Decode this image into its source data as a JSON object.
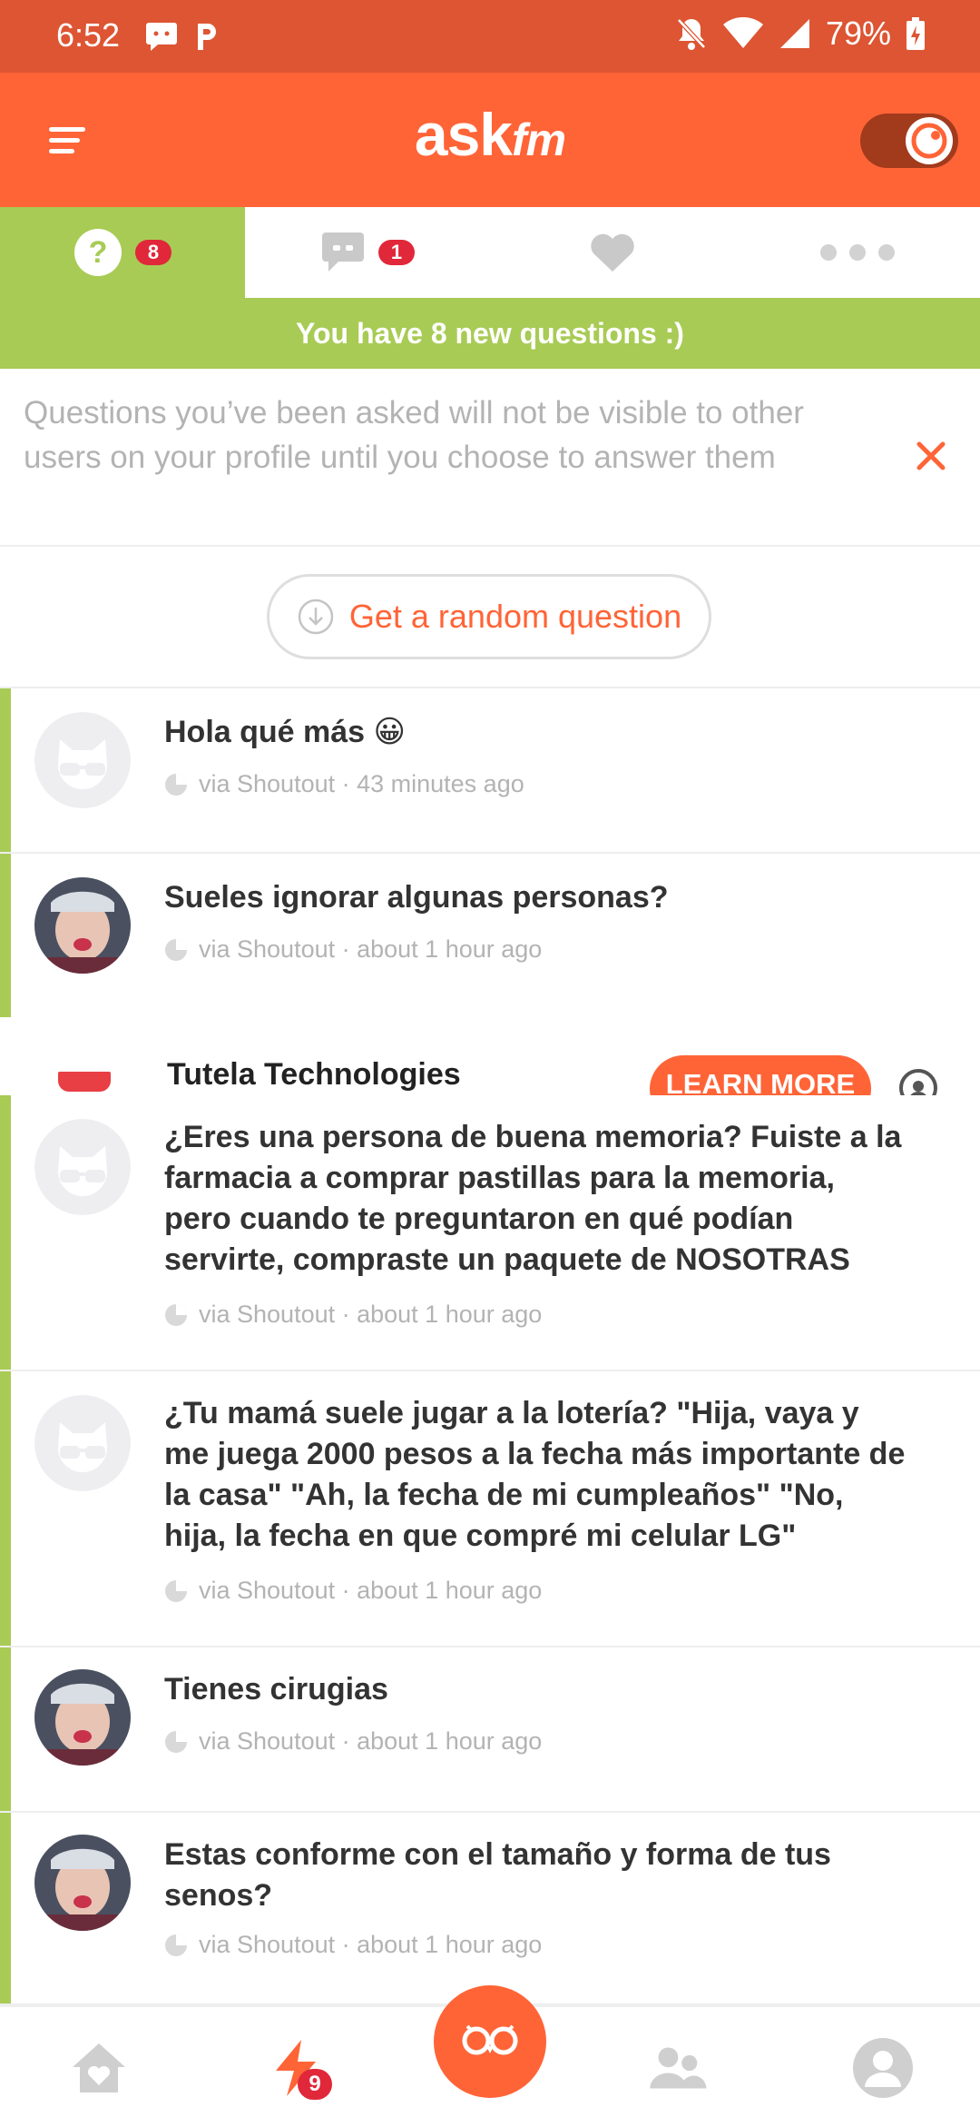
{
  "status_bar": {
    "time": "6:52",
    "battery": "79%",
    "icons_left": [
      "chat-notification-icon",
      "parking-icon"
    ],
    "icons_right": [
      "bell-off-icon",
      "wifi-icon",
      "cell-signal-icon",
      "battery-charging-icon"
    ]
  },
  "app_bar": {
    "logo_main": "ask",
    "logo_suffix": "fm",
    "toggle_on": true
  },
  "tabs": [
    {
      "icon": "question-icon",
      "badge": "8",
      "active": true
    },
    {
      "icon": "chat-icon",
      "badge": "1",
      "active": false
    },
    {
      "icon": "heart-icon",
      "badge": "",
      "active": false
    },
    {
      "icon": "more-dots-icon",
      "badge": "",
      "active": false
    }
  ],
  "banner": {
    "text": "You have 8 new questions :)"
  },
  "notice": {
    "text": "Questions you’ve been asked will not be visible to other users on your profile until you choose to answer them"
  },
  "random_button": {
    "label": "Get a random question"
  },
  "questions": [
    {
      "text": "Hola qué más 😀",
      "meta": "via Shoutout · 43 minutes ago",
      "avatar": "default"
    },
    {
      "text": "Sueles ignorar algunas personas?",
      "meta": "via Shoutout · about 1 hour ago",
      "avatar": "photo"
    },
    {
      "text": "¿Eres una persona de buena memoria? Fuiste a la farmacia a comprar pastillas para la memoria, pero cuando te preguntaron en qué podían servirte, compraste un paquete de NOSOTRAS",
      "meta": "via Shoutout · about 1 hour ago",
      "avatar": "default"
    },
    {
      "text": "¿Tu mamá suele jugar a la lotería? \"Hija, vaya y me juega 2000 pesos a la fecha más importante de la casa\" \"Ah, la fecha de mi cumpleaños\" \"No, hija, la fecha en que compré mi celular LG\"",
      "meta": "via Shoutout · about 1 hour ago",
      "avatar": "default"
    },
    {
      "text": "Tienes cirugias",
      "meta": "via Shoutout · about 1 hour ago",
      "avatar": "photo"
    },
    {
      "text": "Estas conforme con el tamaño y forma de tus senos?",
      "meta": "via Shoutout · about 1 hour ago",
      "avatar": "photo"
    }
  ],
  "ad": {
    "advertiser": "Tutela Technologies",
    "cta": "LEARN MORE"
  },
  "bottom_nav": {
    "items": [
      "home-icon",
      "activity-icon",
      "owl-icon",
      "friends-icon",
      "profile-icon"
    ],
    "activity_badge": "9"
  },
  "colors": {
    "brand": "#ff6437",
    "accent_green": "#a8cb55",
    "badge_red": "#e0283a"
  }
}
